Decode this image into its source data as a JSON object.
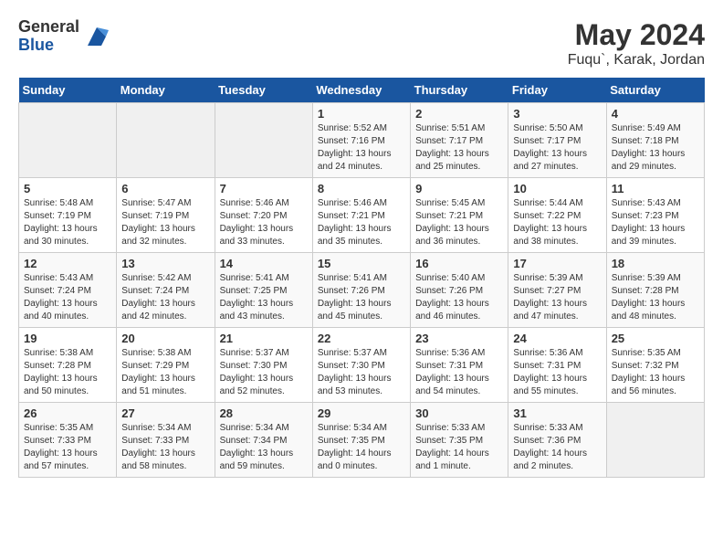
{
  "header": {
    "logo": {
      "general": "General",
      "blue": "Blue"
    },
    "title": "May 2024",
    "subtitle": "Fuqu`, Karak, Jordan"
  },
  "days_of_week": [
    "Sunday",
    "Monday",
    "Tuesday",
    "Wednesday",
    "Thursday",
    "Friday",
    "Saturday"
  ],
  "weeks": [
    [
      {
        "num": "",
        "empty": true
      },
      {
        "num": "",
        "empty": true
      },
      {
        "num": "",
        "empty": true
      },
      {
        "num": "1",
        "sunrise": "5:52 AM",
        "sunset": "7:16 PM",
        "daylight": "13 hours and 24 minutes."
      },
      {
        "num": "2",
        "sunrise": "5:51 AM",
        "sunset": "7:17 PM",
        "daylight": "13 hours and 25 minutes."
      },
      {
        "num": "3",
        "sunrise": "5:50 AM",
        "sunset": "7:17 PM",
        "daylight": "13 hours and 27 minutes."
      },
      {
        "num": "4",
        "sunrise": "5:49 AM",
        "sunset": "7:18 PM",
        "daylight": "13 hours and 29 minutes."
      }
    ],
    [
      {
        "num": "5",
        "sunrise": "5:48 AM",
        "sunset": "7:19 PM",
        "daylight": "13 hours and 30 minutes."
      },
      {
        "num": "6",
        "sunrise": "5:47 AM",
        "sunset": "7:19 PM",
        "daylight": "13 hours and 32 minutes."
      },
      {
        "num": "7",
        "sunrise": "5:46 AM",
        "sunset": "7:20 PM",
        "daylight": "13 hours and 33 minutes."
      },
      {
        "num": "8",
        "sunrise": "5:46 AM",
        "sunset": "7:21 PM",
        "daylight": "13 hours and 35 minutes."
      },
      {
        "num": "9",
        "sunrise": "5:45 AM",
        "sunset": "7:21 PM",
        "daylight": "13 hours and 36 minutes."
      },
      {
        "num": "10",
        "sunrise": "5:44 AM",
        "sunset": "7:22 PM",
        "daylight": "13 hours and 38 minutes."
      },
      {
        "num": "11",
        "sunrise": "5:43 AM",
        "sunset": "7:23 PM",
        "daylight": "13 hours and 39 minutes."
      }
    ],
    [
      {
        "num": "12",
        "sunrise": "5:43 AM",
        "sunset": "7:24 PM",
        "daylight": "13 hours and 40 minutes."
      },
      {
        "num": "13",
        "sunrise": "5:42 AM",
        "sunset": "7:24 PM",
        "daylight": "13 hours and 42 minutes."
      },
      {
        "num": "14",
        "sunrise": "5:41 AM",
        "sunset": "7:25 PM",
        "daylight": "13 hours and 43 minutes."
      },
      {
        "num": "15",
        "sunrise": "5:41 AM",
        "sunset": "7:26 PM",
        "daylight": "13 hours and 45 minutes."
      },
      {
        "num": "16",
        "sunrise": "5:40 AM",
        "sunset": "7:26 PM",
        "daylight": "13 hours and 46 minutes."
      },
      {
        "num": "17",
        "sunrise": "5:39 AM",
        "sunset": "7:27 PM",
        "daylight": "13 hours and 47 minutes."
      },
      {
        "num": "18",
        "sunrise": "5:39 AM",
        "sunset": "7:28 PM",
        "daylight": "13 hours and 48 minutes."
      }
    ],
    [
      {
        "num": "19",
        "sunrise": "5:38 AM",
        "sunset": "7:28 PM",
        "daylight": "13 hours and 50 minutes."
      },
      {
        "num": "20",
        "sunrise": "5:38 AM",
        "sunset": "7:29 PM",
        "daylight": "13 hours and 51 minutes."
      },
      {
        "num": "21",
        "sunrise": "5:37 AM",
        "sunset": "7:30 PM",
        "daylight": "13 hours and 52 minutes."
      },
      {
        "num": "22",
        "sunrise": "5:37 AM",
        "sunset": "7:30 PM",
        "daylight": "13 hours and 53 minutes."
      },
      {
        "num": "23",
        "sunrise": "5:36 AM",
        "sunset": "7:31 PM",
        "daylight": "13 hours and 54 minutes."
      },
      {
        "num": "24",
        "sunrise": "5:36 AM",
        "sunset": "7:31 PM",
        "daylight": "13 hours and 55 minutes."
      },
      {
        "num": "25",
        "sunrise": "5:35 AM",
        "sunset": "7:32 PM",
        "daylight": "13 hours and 56 minutes."
      }
    ],
    [
      {
        "num": "26",
        "sunrise": "5:35 AM",
        "sunset": "7:33 PM",
        "daylight": "13 hours and 57 minutes."
      },
      {
        "num": "27",
        "sunrise": "5:34 AM",
        "sunset": "7:33 PM",
        "daylight": "13 hours and 58 minutes."
      },
      {
        "num": "28",
        "sunrise": "5:34 AM",
        "sunset": "7:34 PM",
        "daylight": "13 hours and 59 minutes."
      },
      {
        "num": "29",
        "sunrise": "5:34 AM",
        "sunset": "7:35 PM",
        "daylight": "14 hours and 0 minutes."
      },
      {
        "num": "30",
        "sunrise": "5:33 AM",
        "sunset": "7:35 PM",
        "daylight": "14 hours and 1 minute."
      },
      {
        "num": "31",
        "sunrise": "5:33 AM",
        "sunset": "7:36 PM",
        "daylight": "14 hours and 2 minutes."
      },
      {
        "num": "",
        "empty": true
      }
    ]
  ]
}
